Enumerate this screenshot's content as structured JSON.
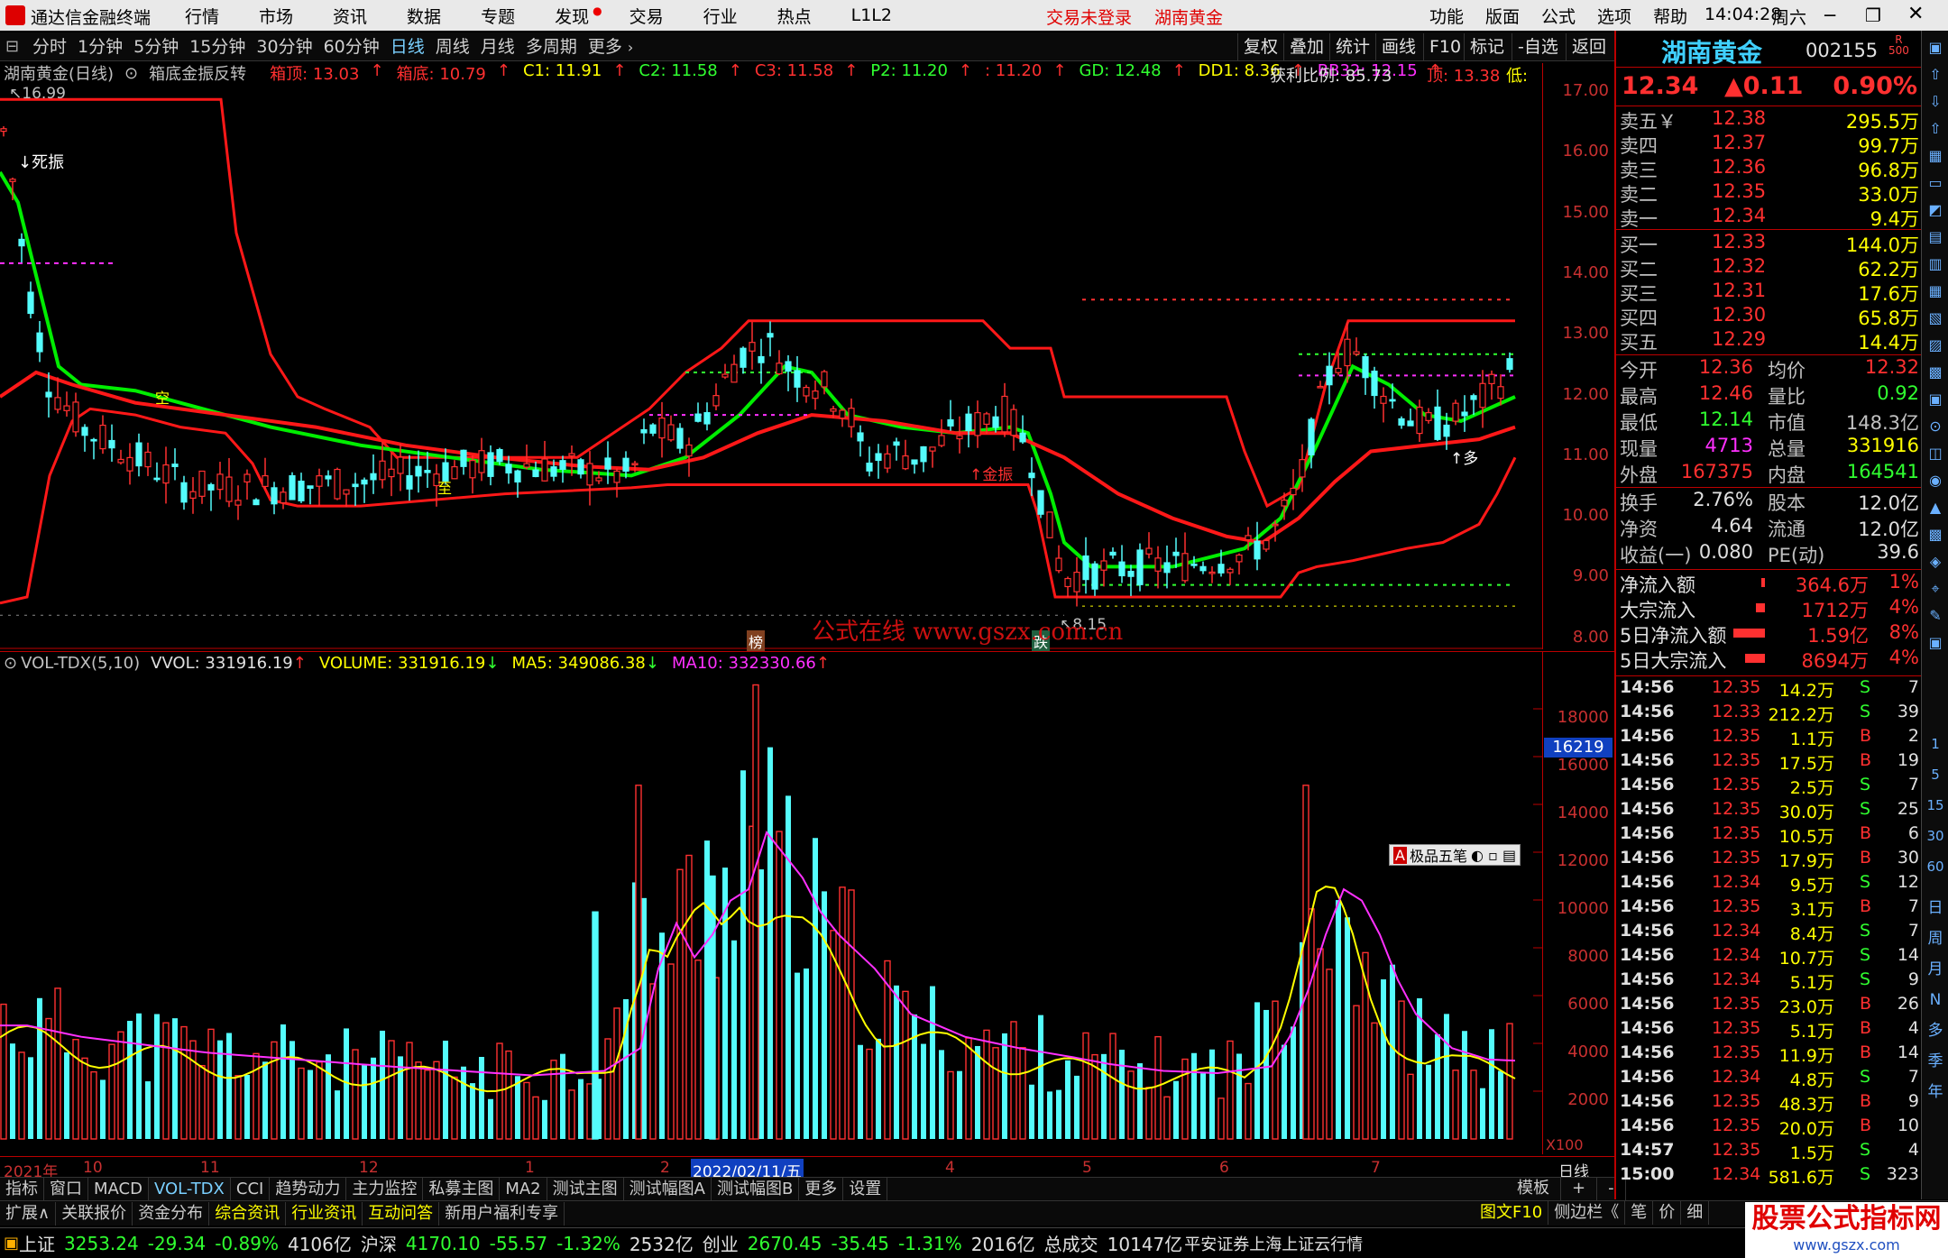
{
  "app": {
    "title": "通达信金融终端",
    "menu": [
      "行情",
      "市场",
      "资讯",
      "数据",
      "专题",
      "发现",
      "交易",
      "行业",
      "热点",
      "L1L2"
    ],
    "status_notice": "交易未登录",
    "current_stock": "湖南黄金",
    "right_menu": [
      "功能",
      "版面",
      "公式",
      "选项",
      "帮助"
    ],
    "time": "14:04:28",
    "weekday": "周六"
  },
  "periods": [
    "分时",
    "1分钟",
    "5分钟",
    "15分钟",
    "30分钟",
    "60分钟",
    "日线",
    "周线",
    "月线",
    "多周期",
    "更多"
  ],
  "active_period": "日线",
  "chart_tools": [
    "复权",
    "叠加",
    "统计",
    "画线",
    "F10",
    "标记",
    "-自选",
    "返回"
  ],
  "main_legend": {
    "name": "湖南黄金(日线)",
    "indicator": "箱底金振反转",
    "items": [
      {
        "t": "箱顶: 13.03",
        "c": "#ff3030"
      },
      {
        "t": "箱底: 10.79",
        "c": "#ff3030"
      },
      {
        "t": "C1: 11.91",
        "c": "#ffff00"
      },
      {
        "t": "C2: 11.58",
        "c": "#30ff30"
      },
      {
        "t": "C3: 11.58",
        "c": "#ff3030"
      },
      {
        "t": "P2: 11.20",
        "c": "#30ff30"
      },
      {
        "t": ": 11.20",
        "c": "#ff3030"
      },
      {
        "t": "GD: 12.48",
        "c": "#30ff30"
      },
      {
        "t": "DD1: 8.36",
        "c": "#ffff00"
      },
      {
        "t": "BB32: 12.15",
        "c": "#ff30ff"
      }
    ],
    "profit_ratio": "获利比例: 85.73",
    "top": "顶: 13.38",
    "low": "低:"
  },
  "main_annotations": {
    "high": "16.99",
    "low": "8.15",
    "dead": "死振",
    "kong": "空",
    "gold": "金振",
    "duo": "多",
    "zhi": "至",
    "tag1": "榜",
    "tag2": "跌",
    "watermark": "公式在线  www.gszx.com.cn"
  },
  "price_axis": [
    "17.00",
    "16.00",
    "15.00",
    "14.00",
    "13.00",
    "12.00",
    "11.00",
    "10.00",
    "9.00",
    "8.00"
  ],
  "volume_legend": {
    "name": "VOL-TDX(5,10)",
    "vvol": "VVOL: 331916.19",
    "volume": "VOLUME: 331916.19",
    "ma5": "MA5: 349086.38",
    "ma10": "MA10: 332330.66"
  },
  "volume_axis": [
    "18000",
    "16000",
    "14000",
    "12000",
    "10000",
    "8000",
    "6000",
    "4000",
    "2000"
  ],
  "volume_highlight": "16219",
  "volume_unit": "X100",
  "floating_toolbar": "极品五笔",
  "date_axis": [
    {
      "t": "2021年"
    },
    {
      "t": "10"
    },
    {
      "t": "11"
    },
    {
      "t": "12"
    },
    {
      "t": "1"
    },
    {
      "t": "2"
    },
    {
      "t": "2022/02/11/五"
    },
    {
      "t": "4"
    },
    {
      "t": "5"
    },
    {
      "t": "6"
    },
    {
      "t": "7"
    }
  ],
  "date_axis_right": "日线",
  "bottom_tabs": [
    "指标",
    "窗口",
    "MACD",
    "VOL-TDX",
    "CCI",
    "趋势动力",
    "主力监控",
    "私募主图",
    "MA2",
    "测试主图",
    "测试幅图A",
    "测试幅图B",
    "更多",
    "设置"
  ],
  "bottom_right": [
    "模板",
    "+",
    "-"
  ],
  "bottom_tabs2": [
    "扩展∧",
    "关联报价",
    "资金分布",
    "综合资讯",
    "行业资讯",
    "互动问答",
    "新用户福利专享"
  ],
  "bottom_tabs2_right": [
    "图文F10",
    "侧边栏《",
    "笔",
    "价",
    "细"
  ],
  "status": {
    "sh": {
      "name": "上证",
      "val": "3253.24",
      "chg": "-29.34",
      "pct": "-0.89%",
      "amt": "4106亿"
    },
    "sz": {
      "name": "沪深",
      "val": "4170.10",
      "chg": "-55.57",
      "pct": "-1.32%",
      "amt": "2532亿"
    },
    "cy": {
      "name": "创业",
      "val": "2670.45",
      "chg": "-35.45",
      "pct": "-1.31%",
      "amt": "2016亿"
    },
    "total": {
      "label": "总成交",
      "amt": "10147亿"
    },
    "broker": "平安证券上海上证云行情",
    "logo": "股票公式指标网",
    "logo_url": "www.gszx.com"
  },
  "quote": {
    "name": "湖南黄金",
    "code": "002155",
    "badge": "R",
    "badge2": "500",
    "price": "12.34",
    "change": "▲0.11",
    "pct": "0.90%",
    "sell": [
      {
        "l": "卖五￥",
        "p": "12.38",
        "v": "295.5万"
      },
      {
        "l": "卖四",
        "p": "12.37",
        "v": "99.7万"
      },
      {
        "l": "卖三",
        "p": "12.36",
        "v": "96.8万"
      },
      {
        "l": "卖二",
        "p": "12.35",
        "v": "33.0万"
      },
      {
        "l": "卖一",
        "p": "12.34",
        "v": "9.4万"
      }
    ],
    "buy": [
      {
        "l": "买一",
        "p": "12.33",
        "v": "144.0万"
      },
      {
        "l": "买二",
        "p": "12.32",
        "v": "62.2万"
      },
      {
        "l": "买三",
        "p": "12.31",
        "v": "17.6万"
      },
      {
        "l": "买四",
        "p": "12.30",
        "v": "65.8万"
      },
      {
        "l": "买五",
        "p": "12.29",
        "v": "14.4万"
      }
    ],
    "stats": [
      {
        "l1": "今开",
        "v1": "12.36",
        "c1": "#ff3030",
        "l2": "均价",
        "v2": "12.32",
        "c2": "#ff3030"
      },
      {
        "l1": "最高",
        "v1": "12.46",
        "c1": "#ff3030",
        "l2": "量比",
        "v2": "0.92",
        "c2": "#30ff30"
      },
      {
        "l1": "最低",
        "v1": "12.14",
        "c1": "#30ff30",
        "l2": "市值",
        "v2": "148.3亿",
        "c2": "#c0c0c0"
      },
      {
        "l1": "现量",
        "v1": "4713",
        "c1": "#ff30ff",
        "l2": "总量",
        "v2": "331916",
        "c2": "#ffff00"
      },
      {
        "l1": "外盘",
        "v1": "167375",
        "c1": "#ff3030",
        "l2": "内盘",
        "v2": "164541",
        "c2": "#30ff30"
      }
    ],
    "fund": [
      {
        "l1": "换手",
        "v1": "2.76%",
        "l2": "股本",
        "v2": "12.0亿"
      },
      {
        "l1": "净资",
        "v1": "4.64",
        "l2": "流通",
        "v2": "12.0亿"
      },
      {
        "l1": "收益(一)",
        "v1": "0.080",
        "l2": "PE(动)",
        "v2": "39.6"
      }
    ],
    "flow": [
      {
        "l": "净流入额",
        "v": "364.6万",
        "p": "1%",
        "w": 4
      },
      {
        "l": "大宗流入",
        "v": "1712万",
        "p": "4%",
        "w": 10
      },
      {
        "l": "5日净流入额",
        "v": "1.59亿",
        "p": "8%",
        "w": 35
      },
      {
        "l": "5日大宗流入",
        "v": "8694万",
        "p": "4%",
        "w": 22
      }
    ],
    "ticks": [
      [
        "14:56",
        "12.35",
        "14.2万",
        "S",
        "7"
      ],
      [
        "14:56",
        "12.33",
        "212.2万",
        "S",
        "39"
      ],
      [
        "14:56",
        "12.35",
        "1.1万",
        "B",
        "2"
      ],
      [
        "14:56",
        "12.35",
        "17.5万",
        "B",
        "19"
      ],
      [
        "14:56",
        "12.35",
        "2.5万",
        "S",
        "7"
      ],
      [
        "14:56",
        "12.35",
        "30.0万",
        "S",
        "25"
      ],
      [
        "14:56",
        "12.35",
        "10.5万",
        "B",
        "6"
      ],
      [
        "14:56",
        "12.35",
        "17.9万",
        "B",
        "30"
      ],
      [
        "14:56",
        "12.34",
        "9.5万",
        "S",
        "12"
      ],
      [
        "14:56",
        "12.35",
        "3.1万",
        "B",
        "7"
      ],
      [
        "14:56",
        "12.34",
        "8.4万",
        "S",
        "7"
      ],
      [
        "14:56",
        "12.34",
        "10.7万",
        "S",
        "14"
      ],
      [
        "14:56",
        "12.34",
        "5.1万",
        "S",
        "9"
      ],
      [
        "14:56",
        "12.35",
        "23.0万",
        "B",
        "26"
      ],
      [
        "14:56",
        "12.35",
        "5.1万",
        "B",
        "4"
      ],
      [
        "14:56",
        "12.35",
        "11.9万",
        "B",
        "14"
      ],
      [
        "14:56",
        "12.34",
        "4.8万",
        "S",
        "7"
      ],
      [
        "14:56",
        "12.35",
        "48.3万",
        "B",
        "9"
      ],
      [
        "14:56",
        "12.35",
        "20.0万",
        "B",
        "10"
      ],
      [
        "14:57",
        "12.35",
        "1.5万",
        "S",
        "4"
      ],
      [
        "15:00",
        "12.34",
        "581.6万",
        "S",
        "323"
      ]
    ]
  },
  "side_labels": [
    "日",
    "周",
    "月",
    "N",
    "多",
    "季",
    "年"
  ],
  "side_nums": [
    "1",
    "5",
    "15",
    "30",
    "60"
  ],
  "colors": {
    "up": "#ff3030",
    "down": "#54fcfc",
    "ma_green": "#00ee00",
    "ma_red": "#ff1818",
    "yellow": "#ffff00",
    "magenta": "#ff30ff"
  }
}
